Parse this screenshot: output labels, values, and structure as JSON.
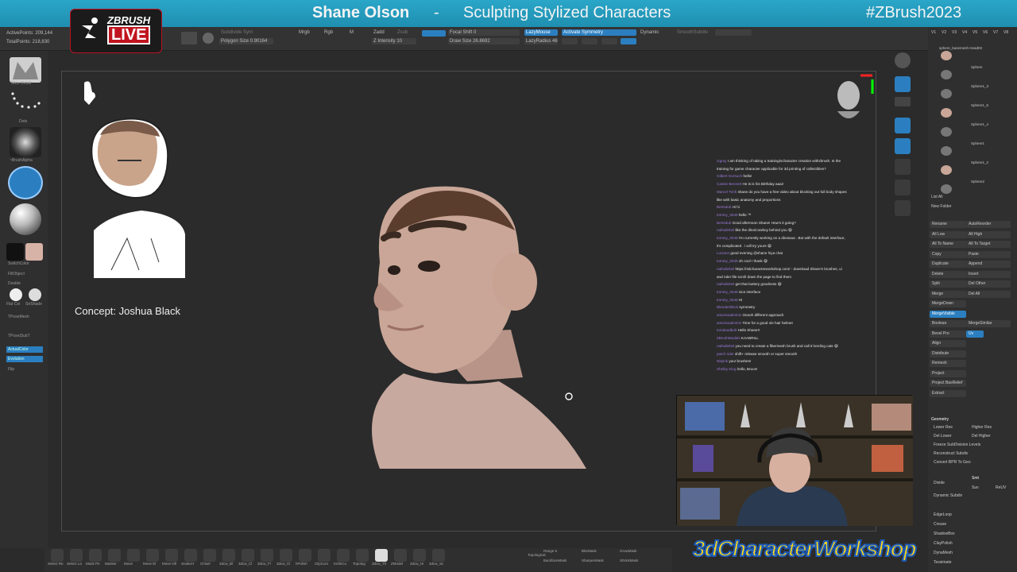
{
  "banner": {
    "presenter": "Shane Olson",
    "separator": "-",
    "topic": "Sculpting Stylized Characters",
    "hashtag": "#ZBrush2023"
  },
  "logo": {
    "line1": "ZBRUSH",
    "line2": "LIVE"
  },
  "toolbar": {
    "active_points": "ActivePoints: 209,144",
    "total_points": "TotalPoints: 218,830",
    "subdivide": "Subdivide Sym",
    "polygon_size": "Polygon Size 0.90164",
    "mrgb": "Mrgb",
    "rgb": "Rgb",
    "m": "M",
    "zadd": "Zadd",
    "zsub": "Zsub",
    "zintensity": "Z Intensity 10",
    "focal_shift": "Focal Shift 0",
    "draw_size": "Draw Size 26.8692",
    "dynamic": "Dynamic",
    "lazy_mouse": "LazyMouse",
    "lazy_radius": "LazyRadius 46",
    "activate_symmetry": "Activate Symmetry",
    "smooth_subdiv": "SmoothSubdiv"
  },
  "left_shelf": {
    "brush_label": "Slice Detail",
    "stroke_label": "Dots",
    "alpha_label": "~BrushAlpha",
    "switch_color": "SwitchColor",
    "fill_object": "FillObject",
    "double": "Double",
    "flat_color": "Flat Col",
    "stroke_shade": "StrShade",
    "tpose_mesh": "TPoseMesh",
    "tpose_subt": "TPose|SubT",
    "actual_color": "ActualColor",
    "evaluation": "Evolution",
    "flip": "Flip",
    "colors": {
      "main": "#ffffff",
      "secondary": "#d7b2a6"
    }
  },
  "viewport": {
    "concept_label": "Concept: Joshua Black"
  },
  "chat": [
    {
      "user": "ctgray",
      "text": "I am thinking of taking a trainingincharacter creation withzbrush. Is the"
    },
    {
      "user": "",
      "text": "training for game character applicable for 3d printing of collectibles?"
    },
    {
      "user": "Gilbert Gorsuch",
      "text": "hello!"
    },
    {
      "user": "Cassie Bennett",
      "text": "He is is his Birthday aaai!"
    },
    {
      "user": "Marcel Trinh",
      "text": "shane do you have a free video about blocking out full body shapes"
    },
    {
      "user": "",
      "text": "like with basic anatomy and proportions"
    },
    {
      "user": "Bertsdub",
      "text": "Hi hi"
    },
    {
      "user": "tommy_0049",
      "text": "hello ™"
    },
    {
      "user": "Bertsdub",
      "text": "Good afternoon Shane! How's it going?"
    },
    {
      "user": "nathaliebel",
      "text": "like the dino/cowboy behind you 😄"
    },
    {
      "user": "tommy_0049",
      "text": "I'm currently working on a dinosaur.. But with the default interface,"
    },
    {
      "user": "",
      "text": "it's complicated . i will try yours 😄"
    },
    {
      "user": "Luciano",
      "text": "good evening @shane hiya chat"
    },
    {
      "user": "tommy_0049",
      "text": "oh cool ! thank 😄"
    },
    {
      "user": "nathaliebel",
      "text": "https://3dcharacterworkshop.com/ - download Shane's brushes, ui"
    },
    {
      "user": "",
      "text": "and ruler file scroll down the page to find them"
    },
    {
      "user": "nathaliebel",
      "text": "get that buttery goodness 😄"
    },
    {
      "user": "tommy_0049",
      "text": "nice interface"
    },
    {
      "user": "tommy_0049",
      "text": "Hi"
    },
    {
      "user": "BlenderBlock",
      "text": "symmetry"
    },
    {
      "user": "antonioadminin",
      "text": "Ooooh different approach"
    },
    {
      "user": "antonioadminin",
      "text": "Time for a good ole hair helmet"
    },
    {
      "user": "tomdeadbolt",
      "text": "Hello Shane!!"
    },
    {
      "user": "ZBrushModels",
      "text": "KAABRILL"
    },
    {
      "user": "nathaliebel",
      "text": "you need to create a fibermesh brush and call it herding cats 😄"
    },
    {
      "user": "patch rider",
      "text": "shift+ release smooth or super smooth"
    },
    {
      "user": "Nitpink",
      "text": "your brushes!"
    },
    {
      "user": "Shelby King",
      "text": "hello, Bruce!"
    },
    {
      "user": "geffe_cave",
      "text": "Just be careful with smooth relax on fibermesh. It will inflat, found out"
    },
    {
      "user": "",
      "text": "the hard way haha"
    }
  ],
  "right_panel": {
    "tabs": [
      "V1",
      "V2",
      "V3",
      "V4",
      "V5",
      "V6",
      "V7",
      "V8"
    ],
    "subtools": [
      "sphere_basemesh Head03",
      "Sphere",
      "Sphere1_3",
      "Sphere1_5",
      "Sphere1_4",
      "Sphere1",
      "Sphere1_2",
      "Sphere2"
    ],
    "list_all": "List All",
    "new_folder": "New Folder",
    "buttons_left": [
      "Rename",
      "All Low",
      "All To Name",
      "Copy",
      "Duplicate",
      "Delete",
      "Split",
      "Merge",
      "MergeDown",
      "MergeVisible",
      "Boolean",
      "Bevel Pro",
      "Align",
      "Distribute",
      "Remesh",
      "Project",
      "Project BasRelief",
      "Extract"
    ],
    "buttons_right": [
      "AutoReorder",
      "All High",
      "All To Target",
      "Paste",
      "Append",
      "Insert",
      "Del Other",
      "Del All",
      "",
      "",
      "MergeSimilar",
      "Uv"
    ],
    "geometry_title": "Geometry",
    "geometry": [
      "Lower Res",
      "Higher Res",
      "Del Lower",
      "Del Higher",
      "Freeze SubDivision Levels",
      "Reconstruct Subdiv",
      "Convert BPR To Geo",
      "Divide",
      "Smt",
      "Suv",
      "ReUV",
      "Dynamic Subdiv",
      "EdgeLoop",
      "Crease",
      "ShadowBox",
      "ClayPolish",
      "DynaMesh",
      "Tessimate"
    ]
  },
  "bottom_bar": {
    "brushes": [
      "Select Re",
      "Select La",
      "Mask Pe",
      "Masker",
      "Move",
      "Move El",
      "Move Infi",
      "SnakeH",
      "Chisel",
      "3dcw_Bl",
      "3dcw_Cl",
      "3dcw_Fl",
      "3dcw_Cl",
      "hPolish",
      "ClipCurv",
      "KnifeCu",
      "Topolog",
      "3dcw_Th",
      "ZModel",
      "3dcw_Hi",
      "3dcw_Sc"
    ],
    "topological": "Topological",
    "range": "Range 5",
    "backface_mask": "BackfaceMask",
    "blur_mask": "BlurMask",
    "sharpen_mask": "SharpenMask",
    "grow_mask": "GrowMask",
    "shrink_mask": "ShrinkMask"
  },
  "workshop_logo": "3dCharacterWorkshop"
}
